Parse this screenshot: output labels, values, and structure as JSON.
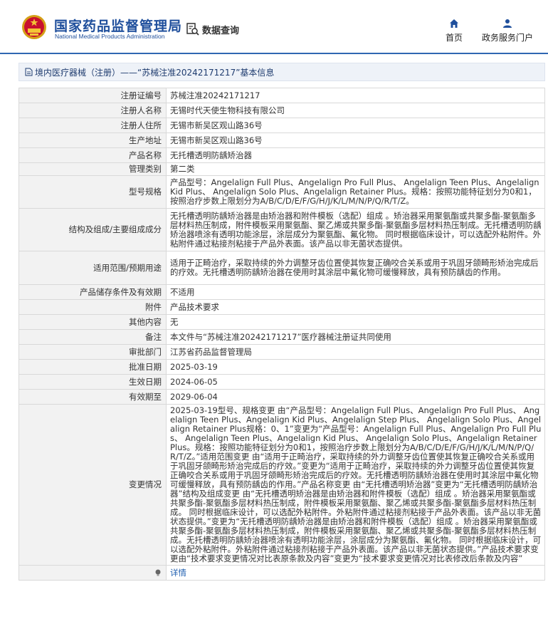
{
  "header": {
    "logo_cn": "国家药品监督管理局",
    "logo_en": "National Medical Products Administration",
    "query_label": "数据查询",
    "nav_home": "首页",
    "nav_portal": "政务服务门户",
    "brand_color": "#1f4f9c"
  },
  "breadcrumb": {
    "text": "境内医疗器械（注册）——“苏械注准20242171217”基本信息"
  },
  "rows": [
    {
      "label": "注册证编号",
      "value": "苏械注准20242171217"
    },
    {
      "label": "注册人名称",
      "value": "无锡时代天使生物科技有限公司"
    },
    {
      "label": "注册人住所",
      "value": "无锡市新吴区观山路36号"
    },
    {
      "label": "生产地址",
      "value": "无锡市新吴区观山路36号"
    },
    {
      "label": "产品名称",
      "value": "无托槽透明防龋矫治器"
    },
    {
      "label": "管理类别",
      "value": "第二类"
    },
    {
      "label": "型号规格",
      "value": "产品型号：Angelalign Full Plus、Angelalign Pro Full Plus、 Angelalign Teen Plus、Angelalign Kid Plus、 Angelalign Solo Plus、Angelalign Retainer Plus。规格：按照功能特征划分为0和1，按照治疗步数上限划分为A/B/C/D/E/F/G/H/J/K/L/M/N/P/Q/R/T/Z。"
    },
    {
      "label": "结构及组成/主要组成成分",
      "value": "无托槽透明防龋矫治器是由矫治器和附件模板（选配）组成 。矫治器采用聚氨酯或共聚多酯-聚氨酯多层材料热压制成，附件模板采用聚氨酯、聚乙烯或共聚多酯-聚氨酯多层材料热压制成。无托槽透明防龋矫治器喷涂有透明功能涂层，涂层成分为聚氨酯、氟化物。 同时根据临床设计，可以选配外粘附件。外粘附件通过粘接剂粘接于产品外表面。该产品以非无菌状态提供。"
    },
    {
      "label": "适用范围/预期用途",
      "value": "适用于正畸治疗，采取持续的外力调整牙齿位置使其恢复正确咬合关系或用于巩固牙颌畸形矫治完成后的疗效。无托槽透明防龋矫治器在使用时其涂层中氟化物可缓慢释放，具有预防龋齿的作用。"
    },
    {
      "label": "产品储存条件及有效期",
      "value": "不适用"
    },
    {
      "label": "附件",
      "value": "产品技术要求"
    },
    {
      "label": "其他内容",
      "value": "无"
    },
    {
      "label": "备注",
      "value": "本文件与“苏械注准20242171217”医疗器械注册证共同使用"
    },
    {
      "label": "审批部门",
      "value": "江苏省药品监督管理局"
    },
    {
      "label": "批准日期",
      "value": "2025-03-19"
    },
    {
      "label": "生效日期",
      "value": "2024-06-05"
    },
    {
      "label": "有效期至",
      "value": "2029-06-04"
    },
    {
      "label": "变更情况",
      "value": "2025-03-19型号、规格变更 由“产品型号：Angelalign Full Plus、Angelalign Pro Full Plus、 Angelalign Teen Plus、Angelalign Kid Plus、Angelalign Step Plus、 Angelalign Solo Plus、Angelalign Retainer Plus规格：0、1”变更为“产品型号：Angelalign Full Plus、Angelalign Pro Full Plus、 Angelalign Teen Plus、Angelalign Kid Plus、 Angelalign Solo Plus、Angelalign Retainer Plus。规格：按照功能特征划分为0和1，按照治疗步数上限划分为A/B/C/D/E/F/G/H/J/K/L/M/N/P/Q/R/T/Z。”适用范围变更 由“适用于正畸治疗，采取持续的外力调整牙齿位置使其恢复正确咬合关系或用于巩固牙颌畸形矫治完成后的疗效。”变更为“适用于正畸治疗，采取持续的外力调整牙齿位置使其恢复正确咬合关系或用于巩固牙颌畸形矫治完成后的疗效。无托槽透明防龋矫治器在使用时其涂层中氟化物可缓慢释放，具有预防龋齿的作用。”产品名称变更 由“无托槽透明矫治器”变更为“无托槽透明防龋矫治器”结构及组成变更 由“无托槽透明矫治器是由矫治器和附件模板（选配）组成 。矫治器采用聚氨酯或共聚多酯-聚氨酯多层材料热压制成，附件模板采用聚氨酯、聚乙烯或共聚多酯-聚氨酯多层材料热压制成。 同时根据临床设计，可以选配外粘附件。外粘附件通过粘接剂粘接于产品外表面。该产品以非无菌状态提供。”变更为“无托槽透明防龋矫治器是由矫治器和附件模板（选配）组成 。矫治器采用聚氨酯或共聚多酯-聚氨酯多层材料热压制成，附件模板采用聚氨酯、聚乙烯或共聚多酯-聚氨酯多层材料热压制成。无托槽透明防龋矫治器喷涂有透明功能涂层，涂层成分为聚氨酯、氟化物。 同时根据临床设计，可以选配外粘附件。外粘附件通过粘接剂粘接于产品外表面。该产品以非无菌状态提供。”产品技术要求变更由“技术要求变更情况对比表原条款及内容”变更为“技术要求变更情况对比表修改后条款及内容”"
    }
  ],
  "detail": {
    "value": "详情"
  }
}
